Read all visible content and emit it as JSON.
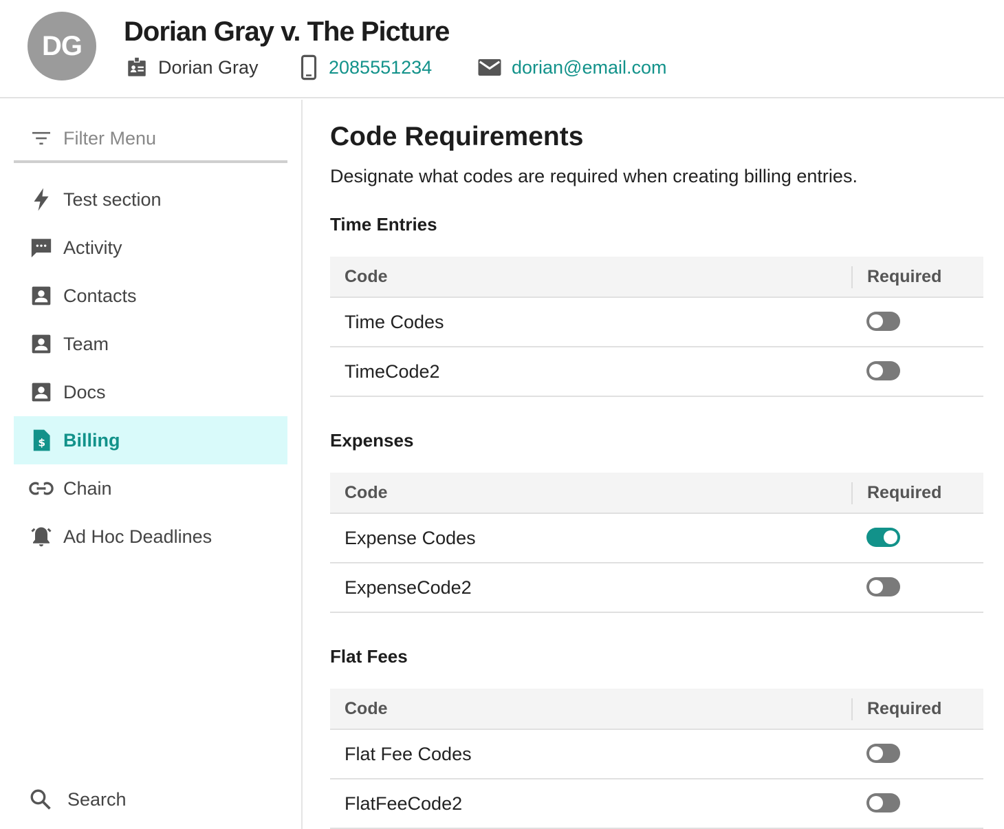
{
  "header": {
    "avatar_initials": "DG",
    "case_title": "Dorian Gray v. The Picture",
    "client_name": "Dorian Gray",
    "phone": "2085551234",
    "email": "dorian@email.com"
  },
  "sidebar": {
    "filter_placeholder": "Filter Menu",
    "items": [
      {
        "label": "Test section",
        "icon": "lightning-icon",
        "active": false
      },
      {
        "label": "Activity",
        "icon": "chat-icon",
        "active": false
      },
      {
        "label": "Contacts",
        "icon": "contact-card-icon",
        "active": false
      },
      {
        "label": "Team",
        "icon": "contact-card-icon",
        "active": false
      },
      {
        "label": "Docs",
        "icon": "contact-card-icon",
        "active": false
      },
      {
        "label": "Billing",
        "icon": "invoice-icon",
        "active": true
      },
      {
        "label": "Chain",
        "icon": "link-icon",
        "active": false
      },
      {
        "label": "Ad Hoc Deadlines",
        "icon": "alarm-bell-icon",
        "active": false
      }
    ],
    "search_label": "Search"
  },
  "main": {
    "title": "Code Requirements",
    "subtitle": "Designate what codes are required when creating billing entries.",
    "sections": [
      {
        "title": "Time Entries",
        "col_code": "Code",
        "col_required": "Required",
        "rows": [
          {
            "label": "Time Codes",
            "required": false
          },
          {
            "label": "TimeCode2",
            "required": false
          }
        ]
      },
      {
        "title": "Expenses",
        "col_code": "Code",
        "col_required": "Required",
        "rows": [
          {
            "label": "Expense Codes",
            "required": true
          },
          {
            "label": "ExpenseCode2",
            "required": false
          }
        ]
      },
      {
        "title": "Flat Fees",
        "col_code": "Code",
        "col_required": "Required",
        "rows": [
          {
            "label": "Flat Fee Codes",
            "required": false
          },
          {
            "label": "FlatFeeCode2",
            "required": false
          }
        ]
      }
    ]
  },
  "colors": {
    "accent": "#12928a",
    "active_bg": "#d9fafa",
    "toggle_off": "#7a7a7a",
    "avatar_bg": "#9b9b9b"
  }
}
